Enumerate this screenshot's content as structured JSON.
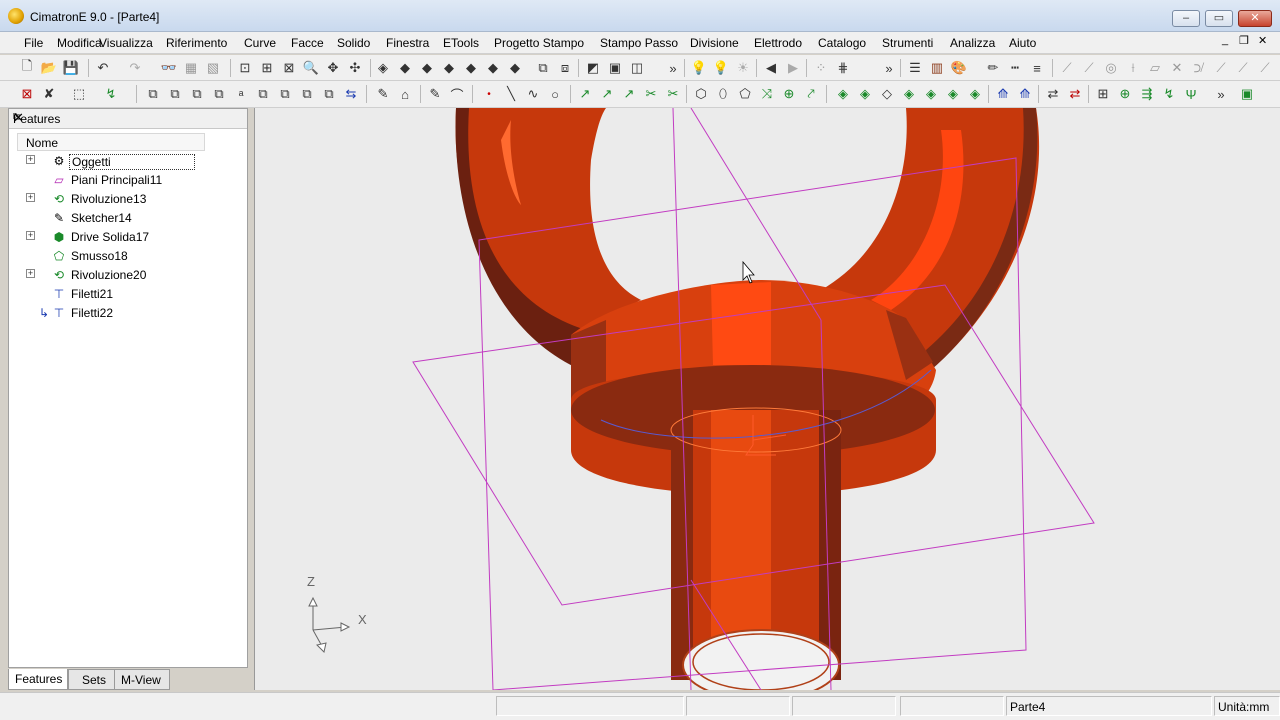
{
  "window": {
    "title": "CimatronE 9.0 - [Parte4]",
    "controls": [
      "minimize",
      "restore",
      "close"
    ]
  },
  "menubar": {
    "items": [
      "File",
      "Modifica",
      "Visualizza",
      "Riferimento",
      "Curve",
      "Facce",
      "Solido",
      "Finestra",
      "ETools",
      "Progetto Stampo",
      "Stampo Passo",
      "Divisione",
      "Elettrodo",
      "Catalogo",
      "Strumenti",
      "Analizza",
      "Aiuto"
    ],
    "mdi_controls": [
      "_",
      "❐",
      "✕"
    ]
  },
  "toolbars": {
    "row1_icons": [
      "new-icon",
      "open-icon",
      "save-icon",
      "undo-icon",
      "redo-icon",
      "glasses-icon",
      "view-icon",
      "zoom-fit-icon",
      "zoom-window-icon",
      "zoom-area-icon",
      "zoom-icon",
      "pan-icon",
      "rotate-icon",
      "cube-iso-icon",
      "cube-top-icon",
      "cube-front-icon",
      "cube-right-icon",
      "cube-left-icon",
      "cube-back-icon",
      "cube-bottom-icon",
      "view-manage-icon",
      "view-list-icon",
      "shading-icon",
      "wire-icon",
      "hidden-icon",
      "bulb-icon",
      "light-icon",
      "light-off-icon",
      "arrow-left-icon",
      "arrow-right-icon",
      "dots-icon",
      "grid-icon",
      "layer-icon",
      "table-icon",
      "color-icon",
      "pen-icon",
      "line-style-icon",
      "line-weight-icon"
    ],
    "row2_icons": [
      "select-icon",
      "delete-icon",
      "filter-icon",
      "pick-icon",
      "copy-icon",
      "move-icon",
      "mirror-icon",
      "rotate2-icon",
      "scale-icon",
      "pattern-icon",
      "transform-icon",
      "swap-icon",
      "sketch-icon",
      "point-icon",
      "line-icon",
      "arc-icon",
      "circle-icon",
      "spline-icon",
      "offset-icon",
      "trim-icon",
      "extend-icon",
      "extrude-icon",
      "revolve-icon",
      "sweep-icon",
      "loft-icon",
      "blend-icon",
      "draft-icon",
      "shell-icon",
      "boolean-icon",
      "face-icon",
      "surface-icon"
    ]
  },
  "features_panel": {
    "title": "Features",
    "pin": "📌",
    "close": "✕",
    "column_header": "Nome",
    "items": [
      {
        "label": "Oggetti",
        "icon": "objects-icon",
        "expandable": true,
        "selected": true
      },
      {
        "label": "Piani Principali11",
        "icon": "planes-icon",
        "expandable": false
      },
      {
        "label": "Rivoluzione13",
        "icon": "revolve-icon",
        "expandable": true
      },
      {
        "label": "Sketcher14",
        "icon": "sketch-icon",
        "expandable": false
      },
      {
        "label": "Drive Solida17",
        "icon": "drive-solid-icon",
        "expandable": true
      },
      {
        "label": "Smusso18",
        "icon": "chamfer-icon",
        "expandable": false
      },
      {
        "label": "Rivoluzione20",
        "icon": "revolve-icon",
        "expandable": true
      },
      {
        "label": "Filetti21",
        "icon": "thread-icon",
        "expandable": false
      },
      {
        "label": "Filetti22",
        "icon": "thread-icon",
        "expandable": false
      }
    ],
    "tabs": [
      "Features",
      "Sets",
      "M-View"
    ],
    "active_tab": "Features"
  },
  "viewport": {
    "axis_z": "Z",
    "axis_x": "X",
    "part_color": "#e8420e",
    "part_shade": "#8a2a10",
    "plane_color": "#c23cc2",
    "background": "#ebebeb"
  },
  "statusbar": {
    "cells": [
      "",
      "",
      "",
      "",
      "",
      "Parte4",
      "Unità:mm"
    ]
  }
}
